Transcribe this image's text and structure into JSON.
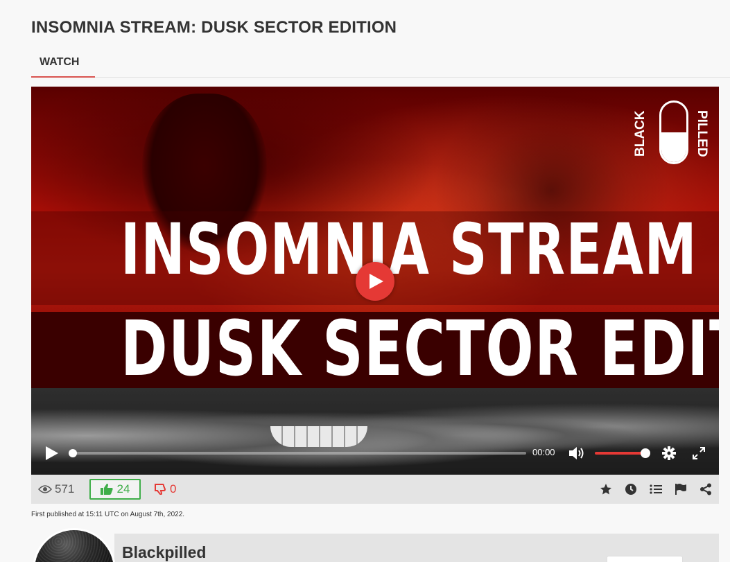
{
  "page": {
    "title": "INSOMNIA STREAM: DUSK SECTOR EDITION"
  },
  "tabs": [
    {
      "label": "WATCH",
      "active": true
    }
  ],
  "video": {
    "thumbnail_line1": "INSOMNIA STREAM",
    "thumbnail_line2": "DUSK SECTOR EDITION",
    "logo_left": "BLACK",
    "logo_right": "PILLED",
    "time": "00:00",
    "progress": 0,
    "volume": 1.0,
    "accent_color": "#e53935"
  },
  "stats": {
    "views": "571",
    "likes": "24",
    "dislikes": "0",
    "like_color": "#3fae49",
    "dislike_color": "#e53935",
    "action_icons": [
      "star-icon",
      "clock-icon",
      "list-icon",
      "flag-icon",
      "share-icon"
    ]
  },
  "published_text": "First published at 15:11 UTC on August 7th, 2022.",
  "channel": {
    "name": "Blackpilled"
  }
}
